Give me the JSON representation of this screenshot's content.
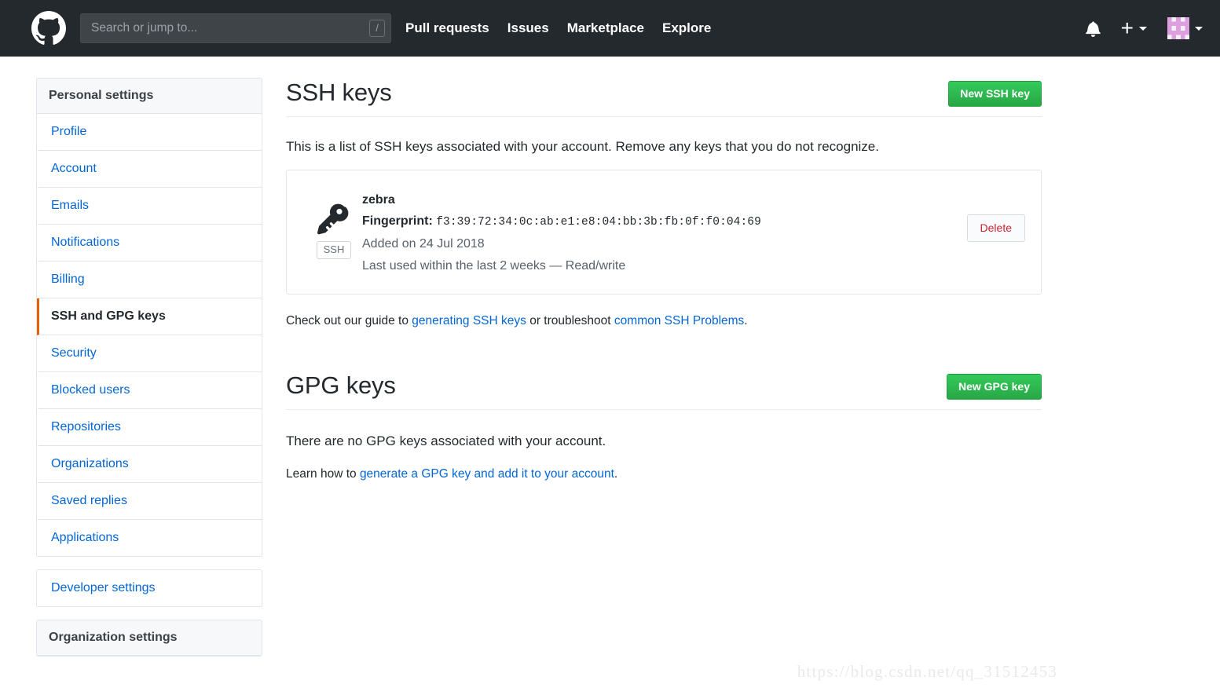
{
  "header": {
    "logo_icon": "github-octocat-logo",
    "search": {
      "placeholder": "Search or jump to...",
      "value": "",
      "shortcut": "/"
    },
    "nav": [
      {
        "label": "Pull requests"
      },
      {
        "label": "Issues"
      },
      {
        "label": "Marketplace"
      },
      {
        "label": "Explore"
      }
    ],
    "notifications_icon": "bell-icon",
    "create_new_label": "+",
    "avatar_icon": "user-identicon-avatar",
    "avatar_colors": {
      "fg": "#dd9fe0",
      "bg": "#f6f0f7"
    },
    "background": "#24292e"
  },
  "sidebar": {
    "personal": {
      "heading": "Personal settings",
      "items": [
        {
          "label": "Profile",
          "active": false
        },
        {
          "label": "Account",
          "active": false
        },
        {
          "label": "Emails",
          "active": false
        },
        {
          "label": "Notifications",
          "active": false
        },
        {
          "label": "Billing",
          "active": false
        },
        {
          "label": "SSH and GPG keys",
          "active": true
        },
        {
          "label": "Security",
          "active": false
        },
        {
          "label": "Blocked users",
          "active": false
        },
        {
          "label": "Repositories",
          "active": false
        },
        {
          "label": "Organizations",
          "active": false
        },
        {
          "label": "Saved replies",
          "active": false
        },
        {
          "label": "Applications",
          "active": false
        }
      ]
    },
    "developer": {
      "label": "Developer settings"
    },
    "organization": {
      "heading": "Organization settings"
    },
    "active_border_color": "#e36209",
    "link_color": "#0366d6"
  },
  "ssh_section": {
    "title": "SSH keys",
    "new_button": "New SSH key",
    "description": "This is a list of SSH keys associated with your account. Remove any keys that you do not recognize.",
    "keys": [
      {
        "icon": "key-icon",
        "badge": "SSH",
        "title": "zebra",
        "fingerprint_label": "Fingerprint:",
        "fingerprint": "f3:39:72:34:0c:ab:e1:e8:04:bb:3b:fb:0f:f0:04:69",
        "added": "Added on 24 Jul 2018",
        "last_used": "Last used within the last 2 weeks — Read/write",
        "delete_label": "Delete"
      }
    ],
    "help": {
      "prefix": "Check out our guide to ",
      "link1": "generating SSH keys",
      "middle": " or troubleshoot ",
      "link2": "common SSH Problems",
      "suffix": "."
    }
  },
  "gpg_section": {
    "title": "GPG keys",
    "new_button": "New GPG key",
    "empty_text": "There are no GPG keys associated with your account.",
    "learn_prefix": "Learn how to ",
    "learn_link": "generate a GPG key and add it to your account",
    "learn_suffix": "."
  },
  "watermark": "https://blog.csdn.net/qq_31512453",
  "accent_colors": {
    "green_button": "#28a745",
    "delete_red": "#cb2431",
    "link_blue": "#0366d6",
    "header_dark": "#24292e"
  }
}
